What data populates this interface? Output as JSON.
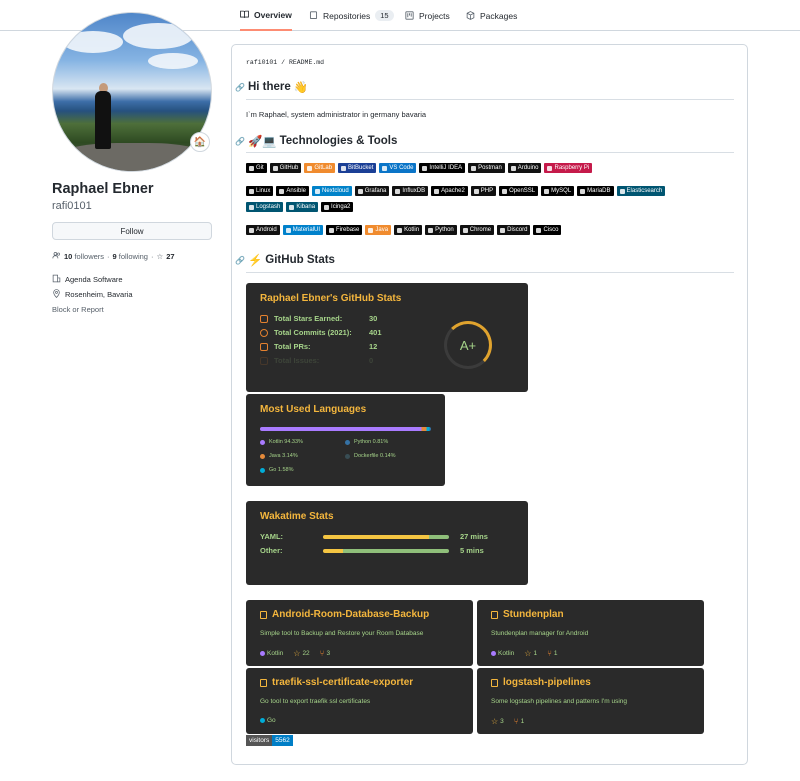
{
  "tabs": [
    {
      "label": "Overview",
      "count": null
    },
    {
      "label": "Repositories",
      "count": "15"
    },
    {
      "label": "Projects",
      "count": null
    },
    {
      "label": "Packages",
      "count": null
    }
  ],
  "profile": {
    "status_emoji": "🏠",
    "name": "Raphael Ebner",
    "login": "rafi0101",
    "follow_label": "Follow",
    "followers_count": "10",
    "followers_label": "followers",
    "following_count": "9",
    "following_label": "following",
    "stars_count": "27",
    "company": "Agenda Software",
    "location": "Rosenheim, Bavaria",
    "block_label": "Block or Report"
  },
  "readme": {
    "crumb_user": "rafi0101",
    "crumb_sep": "/",
    "crumb_file": "README.md",
    "h1_text": "Hi there",
    "h1_emoji": "👋",
    "intro": "I`m Raphael, system administrator in germany bavaria",
    "h2_tech_emoji": "🚀💻",
    "h2_tech": "Technologies & Tools",
    "h2_stats_emoji": "⚡",
    "h2_stats": "GitHub Stats"
  },
  "badges_row1": [
    {
      "label": "Git",
      "color": "#000000"
    },
    {
      "label": "GitHub",
      "color": "#111111"
    },
    {
      "label": "GitLab",
      "color": "#f08b2e"
    },
    {
      "label": "BitBucket",
      "color": "#1b3f96"
    },
    {
      "label": "VS Code",
      "color": "#0b75c8"
    },
    {
      "label": "IntelliJ IDEA",
      "color": "#000000"
    },
    {
      "label": "Postman",
      "color": "#111111"
    },
    {
      "label": "Arduino",
      "color": "#111111"
    },
    {
      "label": "Raspberry Pi",
      "color": "#c51a4a"
    }
  ],
  "badges_row2": [
    {
      "label": "Linux",
      "color": "#000000"
    },
    {
      "label": "Ansible",
      "color": "#000000"
    },
    {
      "label": "Nextcloud",
      "color": "#0082c9"
    },
    {
      "label": "Grafana",
      "color": "#111111"
    },
    {
      "label": "InfluxDB",
      "color": "#111111"
    },
    {
      "label": "Apache2",
      "color": "#000000"
    },
    {
      "label": "PHP",
      "color": "#111111"
    },
    {
      "label": "OpenSSL",
      "color": "#000000"
    },
    {
      "label": "MySQL",
      "color": "#000000"
    },
    {
      "label": "MariaDB",
      "color": "#000000"
    },
    {
      "label": "Elasticsearch",
      "color": "#005571"
    }
  ],
  "badges_row3": [
    {
      "label": "Logstash",
      "color": "#005571"
    },
    {
      "label": "Kibana",
      "color": "#005571"
    },
    {
      "label": "Icinga2",
      "color": "#000000"
    }
  ],
  "badges_row4": [
    {
      "label": "Android",
      "color": "#111111"
    },
    {
      "label": "MaterialUI",
      "color": "#0081cb"
    },
    {
      "label": "Firebase",
      "color": "#000000"
    },
    {
      "label": "Java",
      "color": "#f08b2e"
    },
    {
      "label": "Kotlin",
      "color": "#111111"
    },
    {
      "label": "Python",
      "color": "#111111"
    },
    {
      "label": "Chrome",
      "color": "#111111"
    },
    {
      "label": "Discord",
      "color": "#111111"
    },
    {
      "label": "Cisco",
      "color": "#000000"
    }
  ],
  "github_stats": {
    "title": "Raphael Ebner's GitHub Stats",
    "rows": [
      {
        "label": "Total Stars Earned:",
        "value": "30"
      },
      {
        "label": "Total Commits (2021):",
        "value": "401"
      },
      {
        "label": "Total PRs:",
        "value": "12"
      },
      {
        "label": "Total Issues:",
        "value": "0"
      }
    ],
    "grade": "A+"
  },
  "languages": {
    "title": "Most Used Languages",
    "items": [
      {
        "label": "Kotlin 94.33%",
        "color": "#a97bff"
      },
      {
        "label": "Python 0.81%",
        "color": "#3572a5"
      },
      {
        "label": "Java 3.14%",
        "color": "#e58a3a"
      },
      {
        "label": "Dockerfile 0.14%",
        "color": "#384d54"
      },
      {
        "label": "Go 1.58%",
        "color": "#00add8"
      }
    ]
  },
  "wakatime": {
    "title": "Wakatime Stats",
    "rows": [
      {
        "label": "YAML:",
        "value": "27 mins",
        "share": 0.84
      },
      {
        "label": "Other:",
        "value": "5 mins",
        "share": 0.16
      }
    ]
  },
  "repos": [
    {
      "name": "Android-Room-Database-Backup",
      "desc": "Simple tool to Backup and Restore your Room Database",
      "lang": "Kotlin",
      "lang_color": "#a97bff",
      "stars": "22",
      "forks": "3"
    },
    {
      "name": "Stundenplan",
      "desc": "Stundenplan manager for Android",
      "lang": "Kotlin",
      "lang_color": "#a97bff",
      "stars": "1",
      "forks": "1"
    },
    {
      "name": "traefik-ssl-certificate-exporter",
      "desc": "Go tool to export traefik ssl certificates",
      "lang": "Go",
      "lang_color": "#00add8",
      "stars": "",
      "forks": ""
    },
    {
      "name": "logstash-pipelines",
      "desc": "Some logstash pipelines and patterns I'm using",
      "lang": "",
      "lang_color": "",
      "stars": "3",
      "forks": "1"
    }
  ],
  "visitors": {
    "label": "visitors",
    "count": "5562"
  }
}
